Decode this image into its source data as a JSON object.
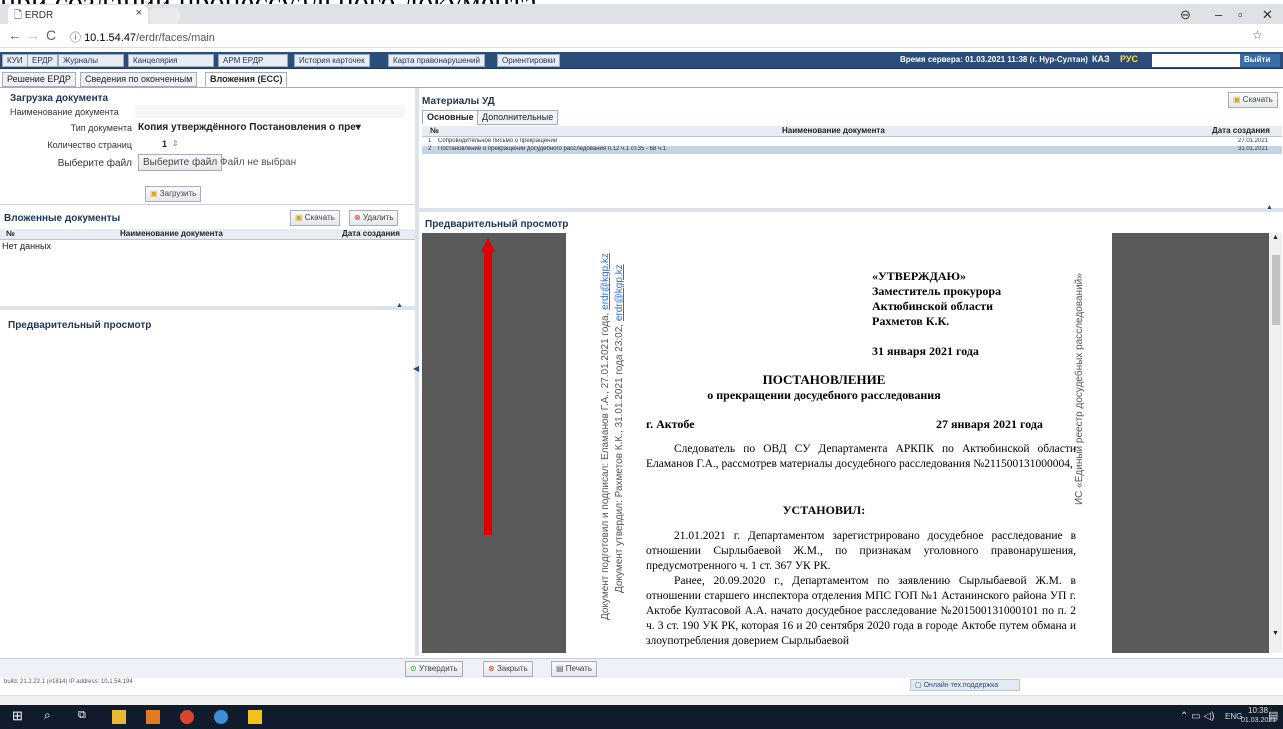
{
  "caption": "при создании процессуального документа.",
  "browser": {
    "tab_title": "ERDR",
    "tab_close": "×",
    "url_host": "10.1.54.47",
    "url_path": "/erdr/faces/main",
    "star": "☆"
  },
  "menu": {
    "items": [
      "КУИ",
      "ЕРДР",
      "Журналы",
      "Канцелярия",
      "АРМ ЕРДР",
      "История карточек",
      "Карта правонарушений",
      "Ориентировки"
    ],
    "server_time": "Время сервера: 01.03.2021 11:38 (г. Нур-Султан)",
    "lang_kz": "КАЗ",
    "lang_ru": "РУС",
    "logout": "Выйти"
  },
  "subtabs": [
    "Решение ЕРДР",
    "Сведения по оконченным",
    "Вложения (ЕСС)"
  ],
  "upload": {
    "title": "Загрузка документа",
    "name_label": "Наименование документа",
    "type_label": "Тип документа",
    "type_value": "Копия утверждённого Постановления о пре▾",
    "pages_label": "Количество страниц",
    "pages_value": "1",
    "file_label": "Выберите файл",
    "file_btn": "Выберите файл",
    "file_none": "Файл не выбран",
    "upload_btn": "Загрузить"
  },
  "attached": {
    "title": "Вложенные документы",
    "download": "Скачать",
    "delete": "Удалить",
    "col_no": "№",
    "col_name": "Наименование документа",
    "col_date": "Дата создания",
    "empty": "Нет данных"
  },
  "preview_left": {
    "title": "Предварительный просмотр"
  },
  "materials": {
    "title": "Материалы УД",
    "download": "Скачать",
    "tab_main": "Основные",
    "tab_extra": "Дополнительные",
    "col_no": "№",
    "col_name": "Наименование документа",
    "col_date": "Дата создания",
    "rows": [
      {
        "no": "1",
        "name": "Сопроводительное письмо о прекращении",
        "date": "27.01.2021"
      },
      {
        "no": "2",
        "name": "Постановление о прекращении досудебного расследования п.12 ч.1 ст.35 - 68 ч.1",
        "date": "31.01.2021"
      }
    ]
  },
  "preview_right": {
    "title": "Предварительный просмотр"
  },
  "document": {
    "approve1": "«УТВЕРЖДАЮ»",
    "approve2": "Заместитель прокурора",
    "approve3": "Актюбинской области",
    "approve4": "Рахметов К.К.",
    "approve_date": "31 января 2021 года",
    "heading": "ПОСТАНОВЛЕНИЕ",
    "subheading": "о прекращении досудебного расследования",
    "city": "г. Актобе",
    "date": "27 января 2021 года",
    "p1": "Следователь по ОВД СУ Департамента АРКПК по Актюбинской области Еламанов Г.А., рассмотрев материалы досудебного расследования №211500131000004,",
    "established": "УСТАНОВИЛ:",
    "p2": "21.01.2021 г. Департаментом зарегистрировано досудебное расследование в отношении Сырлыбаевой Ж.М., по признакам уголовного правонарушения, предусмотренного ч. 1 ст. 367 УК РК.",
    "p3": "Ранее, 20.09.2020 г., Департаментом по заявлению Сырлыбаевой Ж.М. в отношении старшего инспектора отделения МПС ГОП №1 Астанинского района УП г. Актобе Култасовой А.А. начато досудебное расследование №201500131000101 по п. 2 ч. 3 ст. 190 УК РК, которая 16 и 20 сентября 2020 года в городе Актобе путем обмана и злоупотребления доверием Сырлыбаевой",
    "side1_a": "Документ подготовил и подписал: Еламанов Г.А., 27.01.2021 года, ",
    "side1_link": "erdr@kgp.kz",
    "side2_a": "Документ утвердил: Рахметов К.К., 31.01.2021 года 23:02, ",
    "side2_link": "erdr@kgp.kz",
    "side_right": "ИС «Единый реестр досудебных расследований»"
  },
  "actions": {
    "approve": "Утвердить",
    "close": "Закрыть",
    "print": "Печать"
  },
  "status": {
    "build": "build: 21.2.22.1 (#1814)  IP address: 10.1.54.194",
    "support": "Онлайн тех.поддержка"
  },
  "taskbar": {
    "time": "10:38",
    "date": "01.03.2021",
    "lang": "ENG"
  }
}
